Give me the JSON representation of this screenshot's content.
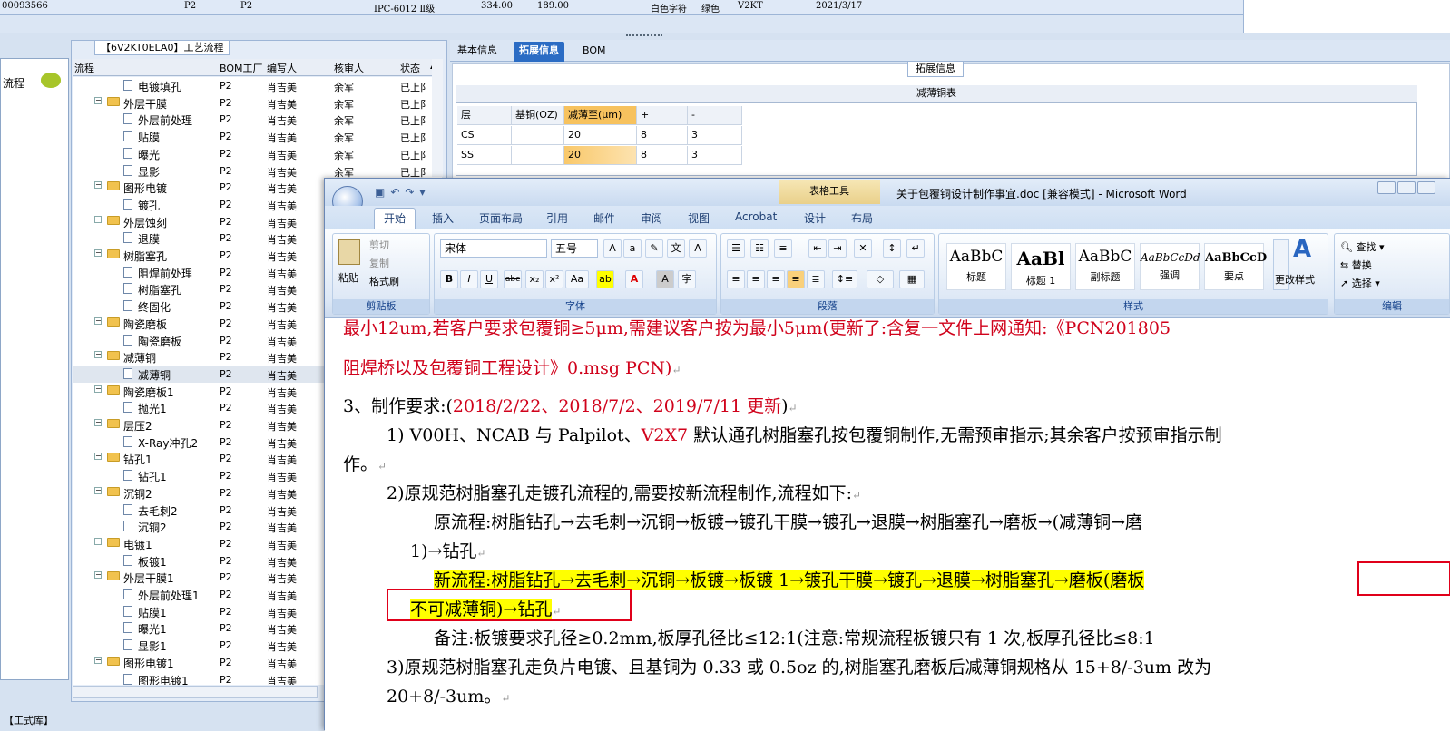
{
  "top_row": {
    "id": "00093566",
    "f1": "P2",
    "f2": "P2",
    "grade": "IPC-6012 Ⅱ级",
    "v1": "334.00",
    "v2": "189.00",
    "chars": "白色字符",
    "color": "绿色",
    "code": "V2KT",
    "date": "2021/3/17"
  },
  "left_panel": {
    "label": "流程"
  },
  "flow_panel": {
    "title": "【6V2KT0ELA0】工艺流程",
    "headers": [
      "流程",
      "BOM工厂",
      "编写人",
      "核审人",
      "状态"
    ],
    "rows": [
      {
        "name": "电镀填孔",
        "type": "doc",
        "lvl": 2,
        "f": "P2",
        "w": "肖吉美",
        "r": "余军",
        "s": "已上阝"
      },
      {
        "name": "外层干膜",
        "type": "folder",
        "lvl": 1,
        "f": "P2",
        "w": "肖吉美",
        "r": "余军",
        "s": "已上阝"
      },
      {
        "name": "外层前处理",
        "type": "doc",
        "lvl": 2,
        "f": "P2",
        "w": "肖吉美",
        "r": "余军",
        "s": "已上阝"
      },
      {
        "name": "贴膜",
        "type": "doc",
        "lvl": 2,
        "f": "P2",
        "w": "肖吉美",
        "r": "余军",
        "s": "已上阝"
      },
      {
        "name": "曝光",
        "type": "doc",
        "lvl": 2,
        "f": "P2",
        "w": "肖吉美",
        "r": "余军",
        "s": "已上阝"
      },
      {
        "name": "显影",
        "type": "doc",
        "lvl": 2,
        "f": "P2",
        "w": "肖吉美",
        "r": "余军",
        "s": "已上阝"
      },
      {
        "name": "图形电镀",
        "type": "folder",
        "lvl": 1,
        "f": "P2",
        "w": "肖吉美",
        "r": "",
        "s": ""
      },
      {
        "name": "镀孔",
        "type": "doc",
        "lvl": 2,
        "f": "P2",
        "w": "肖吉美",
        "r": "",
        "s": ""
      },
      {
        "name": "外层蚀刻",
        "type": "folder",
        "lvl": 1,
        "f": "P2",
        "w": "肖吉美",
        "r": "",
        "s": ""
      },
      {
        "name": "退膜",
        "type": "doc",
        "lvl": 2,
        "f": "P2",
        "w": "肖吉美",
        "r": "",
        "s": ""
      },
      {
        "name": "树脂塞孔",
        "type": "folder",
        "lvl": 1,
        "f": "P2",
        "w": "肖吉美",
        "r": "",
        "s": ""
      },
      {
        "name": "阻焊前处理",
        "type": "doc",
        "lvl": 2,
        "f": "P2",
        "w": "肖吉美",
        "r": "",
        "s": ""
      },
      {
        "name": "树脂塞孔",
        "type": "doc",
        "lvl": 2,
        "f": "P2",
        "w": "肖吉美",
        "r": "",
        "s": ""
      },
      {
        "name": "终固化",
        "type": "doc",
        "lvl": 2,
        "f": "P2",
        "w": "肖吉美",
        "r": "",
        "s": ""
      },
      {
        "name": "陶瓷磨板",
        "type": "folder",
        "lvl": 1,
        "f": "P2",
        "w": "肖吉美",
        "r": "",
        "s": ""
      },
      {
        "name": "陶瓷磨板",
        "type": "doc",
        "lvl": 2,
        "f": "P2",
        "w": "肖吉美",
        "r": "",
        "s": ""
      },
      {
        "name": "减薄铜",
        "type": "folder",
        "lvl": 1,
        "f": "P2",
        "w": "肖吉美",
        "r": "",
        "s": ""
      },
      {
        "name": "减薄铜",
        "type": "doc",
        "lvl": 2,
        "f": "P2",
        "w": "肖吉美",
        "r": "",
        "s": "",
        "sel": true
      },
      {
        "name": "陶瓷磨板1",
        "type": "folder",
        "lvl": 1,
        "f": "P2",
        "w": "肖吉美",
        "r": "",
        "s": ""
      },
      {
        "name": "抛光1",
        "type": "doc",
        "lvl": 2,
        "f": "P2",
        "w": "肖吉美",
        "r": "",
        "s": ""
      },
      {
        "name": "层压2",
        "type": "folder",
        "lvl": 1,
        "f": "P2",
        "w": "肖吉美",
        "r": "",
        "s": ""
      },
      {
        "name": "X-Ray冲孔2",
        "type": "doc",
        "lvl": 2,
        "f": "P2",
        "w": "肖吉美",
        "r": "",
        "s": ""
      },
      {
        "name": "钻孔1",
        "type": "folder",
        "lvl": 1,
        "f": "P2",
        "w": "肖吉美",
        "r": "",
        "s": ""
      },
      {
        "name": "钻孔1",
        "type": "doc",
        "lvl": 2,
        "f": "P2",
        "w": "肖吉美",
        "r": "",
        "s": ""
      },
      {
        "name": "沉铜2",
        "type": "folder",
        "lvl": 1,
        "f": "P2",
        "w": "肖吉美",
        "r": "",
        "s": ""
      },
      {
        "name": "去毛刺2",
        "type": "doc",
        "lvl": 2,
        "f": "P2",
        "w": "肖吉美",
        "r": "",
        "s": ""
      },
      {
        "name": "沉铜2",
        "type": "doc",
        "lvl": 2,
        "f": "P2",
        "w": "肖吉美",
        "r": "",
        "s": ""
      },
      {
        "name": "电镀1",
        "type": "folder",
        "lvl": 1,
        "f": "P2",
        "w": "肖吉美",
        "r": "",
        "s": ""
      },
      {
        "name": "板镀1",
        "type": "doc",
        "lvl": 2,
        "f": "P2",
        "w": "肖吉美",
        "r": "",
        "s": ""
      },
      {
        "name": "外层干膜1",
        "type": "folder",
        "lvl": 1,
        "f": "P2",
        "w": "肖吉美",
        "r": "",
        "s": ""
      },
      {
        "name": "外层前处理1",
        "type": "doc",
        "lvl": 2,
        "f": "P2",
        "w": "肖吉美",
        "r": "",
        "s": ""
      },
      {
        "name": "贴膜1",
        "type": "doc",
        "lvl": 2,
        "f": "P2",
        "w": "肖吉美",
        "r": "",
        "s": ""
      },
      {
        "name": "曝光1",
        "type": "doc",
        "lvl": 2,
        "f": "P2",
        "w": "肖吉美",
        "r": "",
        "s": ""
      },
      {
        "name": "显影1",
        "type": "doc",
        "lvl": 2,
        "f": "P2",
        "w": "肖吉美",
        "r": "",
        "s": ""
      },
      {
        "name": "图形电镀1",
        "type": "folder",
        "lvl": 1,
        "f": "P2",
        "w": "肖吉美",
        "r": "",
        "s": ""
      },
      {
        "name": "图形电镀1",
        "type": "doc",
        "lvl": 2,
        "f": "P2",
        "w": "肖吉美",
        "r": "",
        "s": ""
      }
    ]
  },
  "bottom_tab": "【工式库】",
  "right_tabs": [
    "基本信息",
    "拓展信息",
    "BOM"
  ],
  "ext": {
    "title": "拓展信息",
    "table_title": "减薄铜表",
    "headers": [
      "层",
      "基铜(OZ)",
      "减薄至(μm)",
      "+",
      "-"
    ],
    "rows": [
      [
        "CS",
        "",
        "20",
        "8",
        "3"
      ],
      [
        "SS",
        "",
        "20",
        "8",
        "3"
      ]
    ]
  },
  "word": {
    "title": "关于包覆铜设计制作事宜.doc [兼容模式] - Microsoft Word",
    "table_tools": "表格工具",
    "tabs": [
      "开始",
      "插入",
      "页面布局",
      "引用",
      "邮件",
      "审阅",
      "视图",
      "Acrobat",
      "设计",
      "布局"
    ],
    "clipboard": {
      "paste": "粘贴",
      "cut": "剪切",
      "copy": "复制",
      "format": "格式刷",
      "label": "剪贴板"
    },
    "font": {
      "name": "宋体",
      "size": "五号",
      "label": "字体"
    },
    "para_label": "段落",
    "styles": [
      {
        "p": "AaBbC",
        "n": "标题"
      },
      {
        "p": "AaBl",
        "n": "标题 1"
      },
      {
        "p": "AaBbC",
        "n": "副标题"
      },
      {
        "p": "AaBbCcDd",
        "n": "强调"
      },
      {
        "p": "AaBbCcD",
        "n": "要点"
      }
    ],
    "styles_label": "样式",
    "change_style": "更改样式",
    "edit": {
      "find": "查找",
      "replace": "替换",
      "select": "选择",
      "label": "编辑"
    },
    "lines": {
      "l0": "最小12um,若客户要求包覆铜≥5μm,需建议客户按为最小5μm(更新了:含复一文件上网通知:《PCN201805",
      "l1": "阻焊桥以及包覆铜工程设计》0.msg  PCN)",
      "l2a": "3、制作要求:(",
      "l2b": "2018/2/22、2018/7/2、2019/7/11 更新",
      "l2c": ")",
      "l3a": "1) V00H、NCAB 与 Palpilot、",
      "l3b": "V2X7",
      "l3c": " 默认通孔树脂塞孔按包覆铜制作,无需预审指示;其余客户按预审指示制",
      "l4": "作。",
      "l5": "2)原规范树脂塞孔走镀孔流程的,需要按新流程制作,流程如下:",
      "l6": "原流程:树脂钻孔→去毛刺→沉铜→板镀→镀孔干膜→镀孔→退膜→树脂塞孔→磨板→(减薄铜→磨",
      "l7": "1)→钻孔",
      "l8a": "新流程:树脂钻孔→去毛刺→沉铜→板镀→板镀 1→镀孔干膜→镀孔→退膜→树脂塞孔→磨板",
      "l8b": "(磨板",
      "l9": "不可减薄铜)→钻孔",
      "l10": "备注:板镀要求孔径≥0.2mm,板厚孔径比≤12:1(注意:常规流程板镀只有 1 次,板厚孔径比≤8:1",
      "l11": "3)原规范树脂塞孔走负片电镀、且基铜为 0.33 或 0.5oz 的,树脂塞孔磨板后减薄铜规格从 15+8/-3um 改为",
      "l12": "20+8/-3um。"
    }
  }
}
